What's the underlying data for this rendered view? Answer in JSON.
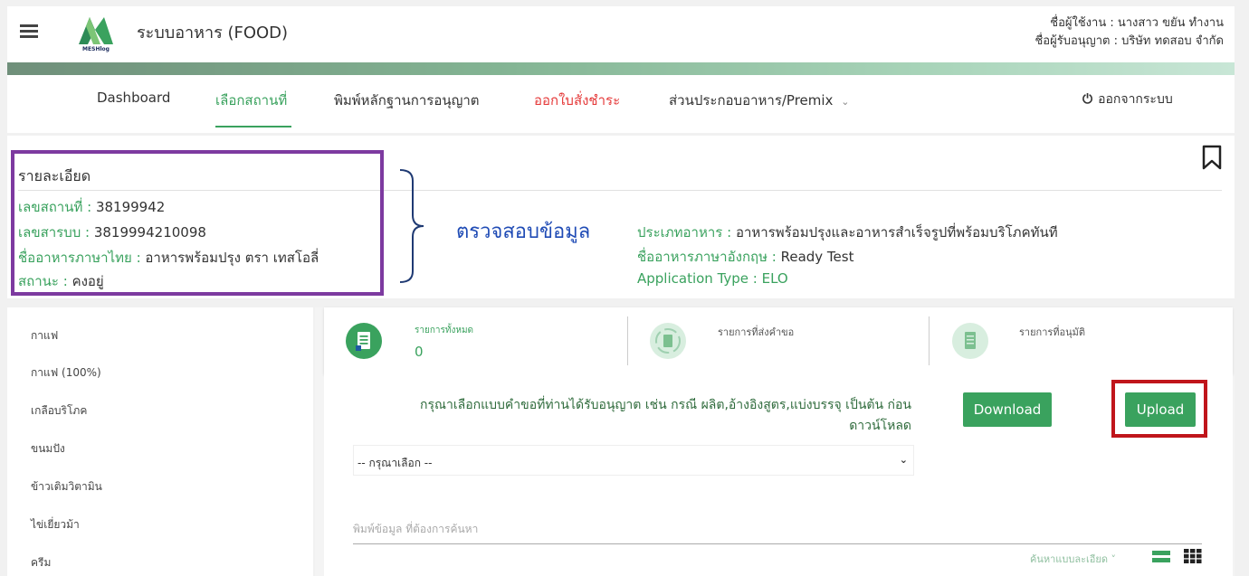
{
  "header": {
    "app_title": "ระบบอาหาร (FOOD)",
    "logo_text": "MESHlog",
    "user_line": "ชื่อผู้ใช้งาน : นางสาว ขยัน ทำงาน",
    "licensee_line": "ชื่อผู้รับอนุญาต : บริษัท ทดสอบ จำกัด",
    "icons": {
      "menu": "hamburger-menu-icon",
      "logo": "meshlog-logo"
    }
  },
  "nav": {
    "dashboard": "Dashboard",
    "select_place": "เลือกสถานที่",
    "print_license": "พิมพ์หลักฐานการอนุญาต",
    "payment": "ออกใบสั่งชำระ",
    "premix": "ส่วนประกอบอาหาร/Premix",
    "logout": "ออกจากระบบ",
    "accent_color": "#3aa25e",
    "alert_color": "#e53a3a"
  },
  "detail": {
    "title": "รายละเอียด",
    "place_no_label": "เลขสถานที่ : ",
    "place_no": "38199942",
    "reg_no_label": "เลขสารบบ : ",
    "reg_no": "3819994210098",
    "thai_name_label": "ชื่ออาหารภาษาไทย : ",
    "thai_name": "อาหารพร้อมปรุง ตรา เทสโอลี่",
    "status_label": "สถานะ : ",
    "status": "คงอยู่",
    "food_type_label": "ประเภทอาหาร : ",
    "food_type": "อาหารพร้อมปรุงและอาหารสำเร็จรูปที่พร้อมบริโภคทันที",
    "eng_name_label": "ชื่ออาหารภาษาอังกฤษ : ",
    "eng_name": "Ready Test",
    "app_type_label": "Application Type : ",
    "app_type": "ELO",
    "verify_annotation": "ตรวจสอบข้อมูล"
  },
  "sidebar": {
    "items": [
      "กาแฟ",
      "กาแฟ (100%)",
      "เกลือบริโภค",
      "ขนมปัง",
      "ข้าวเติมวิตามิน",
      "ไข่เยี่ยวม้า",
      "ครีม"
    ]
  },
  "stats": {
    "total_label": "รายการทั้งหมด",
    "total_count": "0",
    "submitted_label": "รายการที่ส่งคำขอ",
    "approved_label": "รายการที่อนุมัติ"
  },
  "main": {
    "instruction": "กรุณาเลือกแบบคำขอที่ท่านได้รับอนุญาต เช่น กรณี ผลิต,อ้างอิงสูตร,แบ่งบรรจุ เป็นต้น ก่อน ดาวน์โหลด",
    "download_label": "Download",
    "upload_label": "Upload",
    "select_value": "-- กรุณาเลือก --",
    "search_placeholder": "พิมพ์ข้อมูล ที่ต้องการค้นหา",
    "advanced_search": "ค้นหาแบบละเอียด ˅"
  }
}
